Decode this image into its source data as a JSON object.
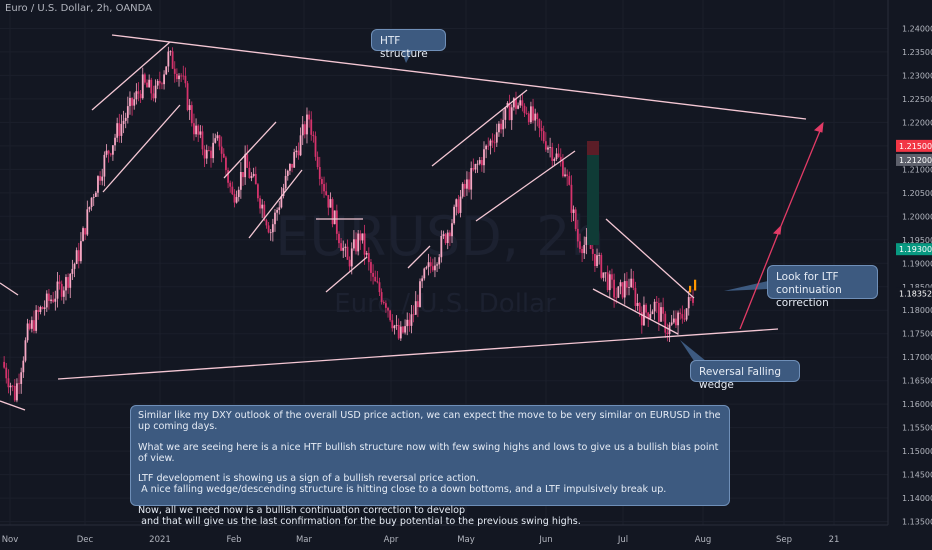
{
  "header": {
    "symbol_title": "Euro / U.S. Dollar, 2h, OANDA"
  },
  "watermark": {
    "symbol": "EURUSD, 2h",
    "name": "Euro / U.S. Dollar"
  },
  "callouts": {
    "htf": "HTF structure",
    "ltf_line1": "Look for LTF",
    "ltf_line2": "continuation correction",
    "wedge": "Reversal Falling wedge"
  },
  "note": {
    "p1": "Similar like my DXY outlook of the overall USD price action, we can expect the move to be very similar on EURUSD in the up coming days.",
    "p2": "What we are seeing here is a nice HTF bullish structure now with few swing highs and lows to give us a bullish bias point of view.",
    "p3a": "LTF development is showing us a sign of a bullish reversal price action.",
    "p3b": " A nice falling wedge/descending structure is hitting close to a down bottoms, and a LTF impulsively break up.",
    "p4a": "Now, all we need now is a bullish continuation correction to develop",
    "p4b": " and that will give us the last confirmation for the buy potential to the previous swing highs."
  },
  "price_tags": [
    {
      "label": "1.21500",
      "value": 1.215,
      "color": "#f23645"
    },
    {
      "label": "1.21200",
      "value": 1.212,
      "color": "#5d606b"
    },
    {
      "label": "1.19300",
      "value": 1.193,
      "color": "#089981"
    },
    {
      "label": "1.18352",
      "value": 1.18352,
      "color": "#131722"
    }
  ],
  "colors": {
    "background": "#131722",
    "candle_up": "#f7a8c4",
    "candle_down": "#d6336c",
    "trendline": "#f4c7d4",
    "arrow": "#e23b66",
    "axis_text": "#b2b5be"
  },
  "chart_data": {
    "type": "candlestick",
    "title": "Euro / U.S. Dollar, 2h, OANDA",
    "x_tick_labels": [
      "Nov",
      "Dec",
      "2021",
      "Feb",
      "Mar",
      "Apr",
      "May",
      "Jun",
      "Jul",
      "Aug",
      "Sep",
      "21"
    ],
    "y_tick_labels": [
      "1.24000",
      "1.23500",
      "1.23000",
      "1.22500",
      "1.22000",
      "1.21500",
      "1.21000",
      "1.20500",
      "1.20000",
      "1.19500",
      "1.19000",
      "1.18500",
      "1.18000",
      "1.17500",
      "1.17000",
      "1.16500",
      "1.16000",
      "1.15500",
      "1.15000",
      "1.14500",
      "1.14000",
      "1.13500"
    ],
    "ylim": [
      1.133,
      1.2435
    ],
    "last_price": 1.18352,
    "price_path": [
      [
        "Nov",
        1.169
      ],
      [
        "Nov",
        1.162
      ],
      [
        "Nov",
        1.175
      ],
      [
        "Nov",
        1.18
      ],
      [
        "Nov",
        1.183
      ],
      [
        "Nov",
        1.186
      ],
      [
        "Nov",
        1.192
      ],
      [
        "Dec",
        1.204
      ],
      [
        "Dec",
        1.212
      ],
      [
        "Dec",
        1.218
      ],
      [
        "Dec",
        1.223
      ],
      [
        "Dec",
        1.228
      ],
      [
        "Dec",
        1.226
      ],
      [
        "2021",
        1.234
      ],
      [
        "2021",
        1.23
      ],
      [
        "2021",
        1.219
      ],
      [
        "2021",
        1.213
      ],
      [
        "2021",
        1.216
      ],
      [
        "Feb",
        1.204
      ],
      [
        "Feb",
        1.211
      ],
      [
        "Feb",
        1.205
      ],
      [
        "Feb",
        1.197
      ],
      [
        "Feb",
        1.206
      ],
      [
        "Feb",
        1.214
      ],
      [
        "Mar",
        1.221
      ],
      [
        "Mar",
        1.208
      ],
      [
        "Mar",
        1.199
      ],
      [
        "Mar",
        1.19
      ],
      [
        "Mar",
        1.196
      ],
      [
        "Mar",
        1.186
      ],
      [
        "Mar",
        1.182
      ],
      [
        "Apr",
        1.174
      ],
      [
        "Apr",
        1.178
      ],
      [
        "Apr",
        1.187
      ],
      [
        "Apr",
        1.192
      ],
      [
        "Apr",
        1.198
      ],
      [
        "May",
        1.205
      ],
      [
        "May",
        1.21
      ],
      [
        "May",
        1.215
      ],
      [
        "May",
        1.22
      ],
      [
        "May",
        1.224
      ],
      [
        "May",
        1.223
      ],
      [
        "Jun",
        1.218
      ],
      [
        "Jun",
        1.214
      ],
      [
        "Jun",
        1.21
      ],
      [
        "Jun",
        1.195
      ],
      [
        "Jun",
        1.193
      ],
      [
        "Jun",
        1.188
      ],
      [
        "Jul",
        1.183
      ],
      [
        "Jul",
        1.186
      ],
      [
        "Jul",
        1.179
      ],
      [
        "Jul",
        1.181
      ],
      [
        "Jul",
        1.176
      ],
      [
        "Jul",
        1.178
      ],
      [
        "Jul",
        1.183
      ]
    ],
    "trendlines": [
      {
        "name": "HTF upper",
        "from": [
          "Nov",
          1.236
        ],
        "to": [
          "Sep",
          1.221
        ]
      },
      {
        "name": "HTF lower",
        "from": [
          "Nov",
          1.166
        ],
        "to": [
          "Aug",
          1.176
        ]
      }
    ],
    "annotations": [
      "HTF structure",
      "Look for LTF continuation correction",
      "Reversal Falling wedge"
    ]
  }
}
